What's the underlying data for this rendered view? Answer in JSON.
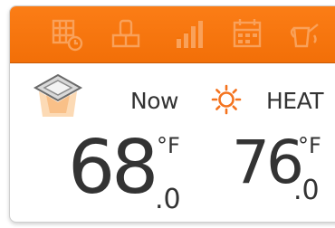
{
  "toolbar": {
    "icons": [
      "schedule-icon",
      "remote-icon",
      "signal-bars-icon",
      "calendar-icon",
      "watering-can-icon"
    ],
    "color": "#f47208"
  },
  "current": {
    "label": "Now",
    "temp_whole": "68",
    "temp_decimal": "0",
    "unit": "°F"
  },
  "setpoint": {
    "mode": "HEAT",
    "temp_whole": "76",
    "temp_decimal": "0",
    "unit": "°F",
    "mode_color": "#f4731e"
  }
}
